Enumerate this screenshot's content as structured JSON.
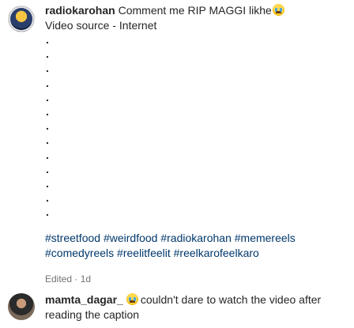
{
  "caption": {
    "username": "radiokarohan",
    "text": "Comment me RIP MAGGI likhe",
    "emoji": "loudly-crying-face-icon",
    "source_line": "Video source - Internet",
    "dots": [
      ".",
      ".",
      ".",
      ".",
      ".",
      ".",
      ".",
      ".",
      ".",
      ".",
      ".",
      ".",
      "."
    ],
    "hashtags": [
      "#streetfood",
      "#weirdfood",
      "#radiokarohan",
      "#memereels",
      "#comedyreels",
      "#reelitfeelit",
      "#reelkarofeelkaro"
    ],
    "edited_label": "Edited",
    "separator": "·",
    "time": "1d"
  },
  "comment": {
    "username": "mamta_dagar_",
    "emoji": "loudly-crying-face-icon",
    "text": "couldn't dare to watch the video after reading the caption"
  },
  "colors": {
    "text": "#262626",
    "hashtag": "#00376b",
    "meta": "#737373",
    "background": "#ffffff"
  }
}
